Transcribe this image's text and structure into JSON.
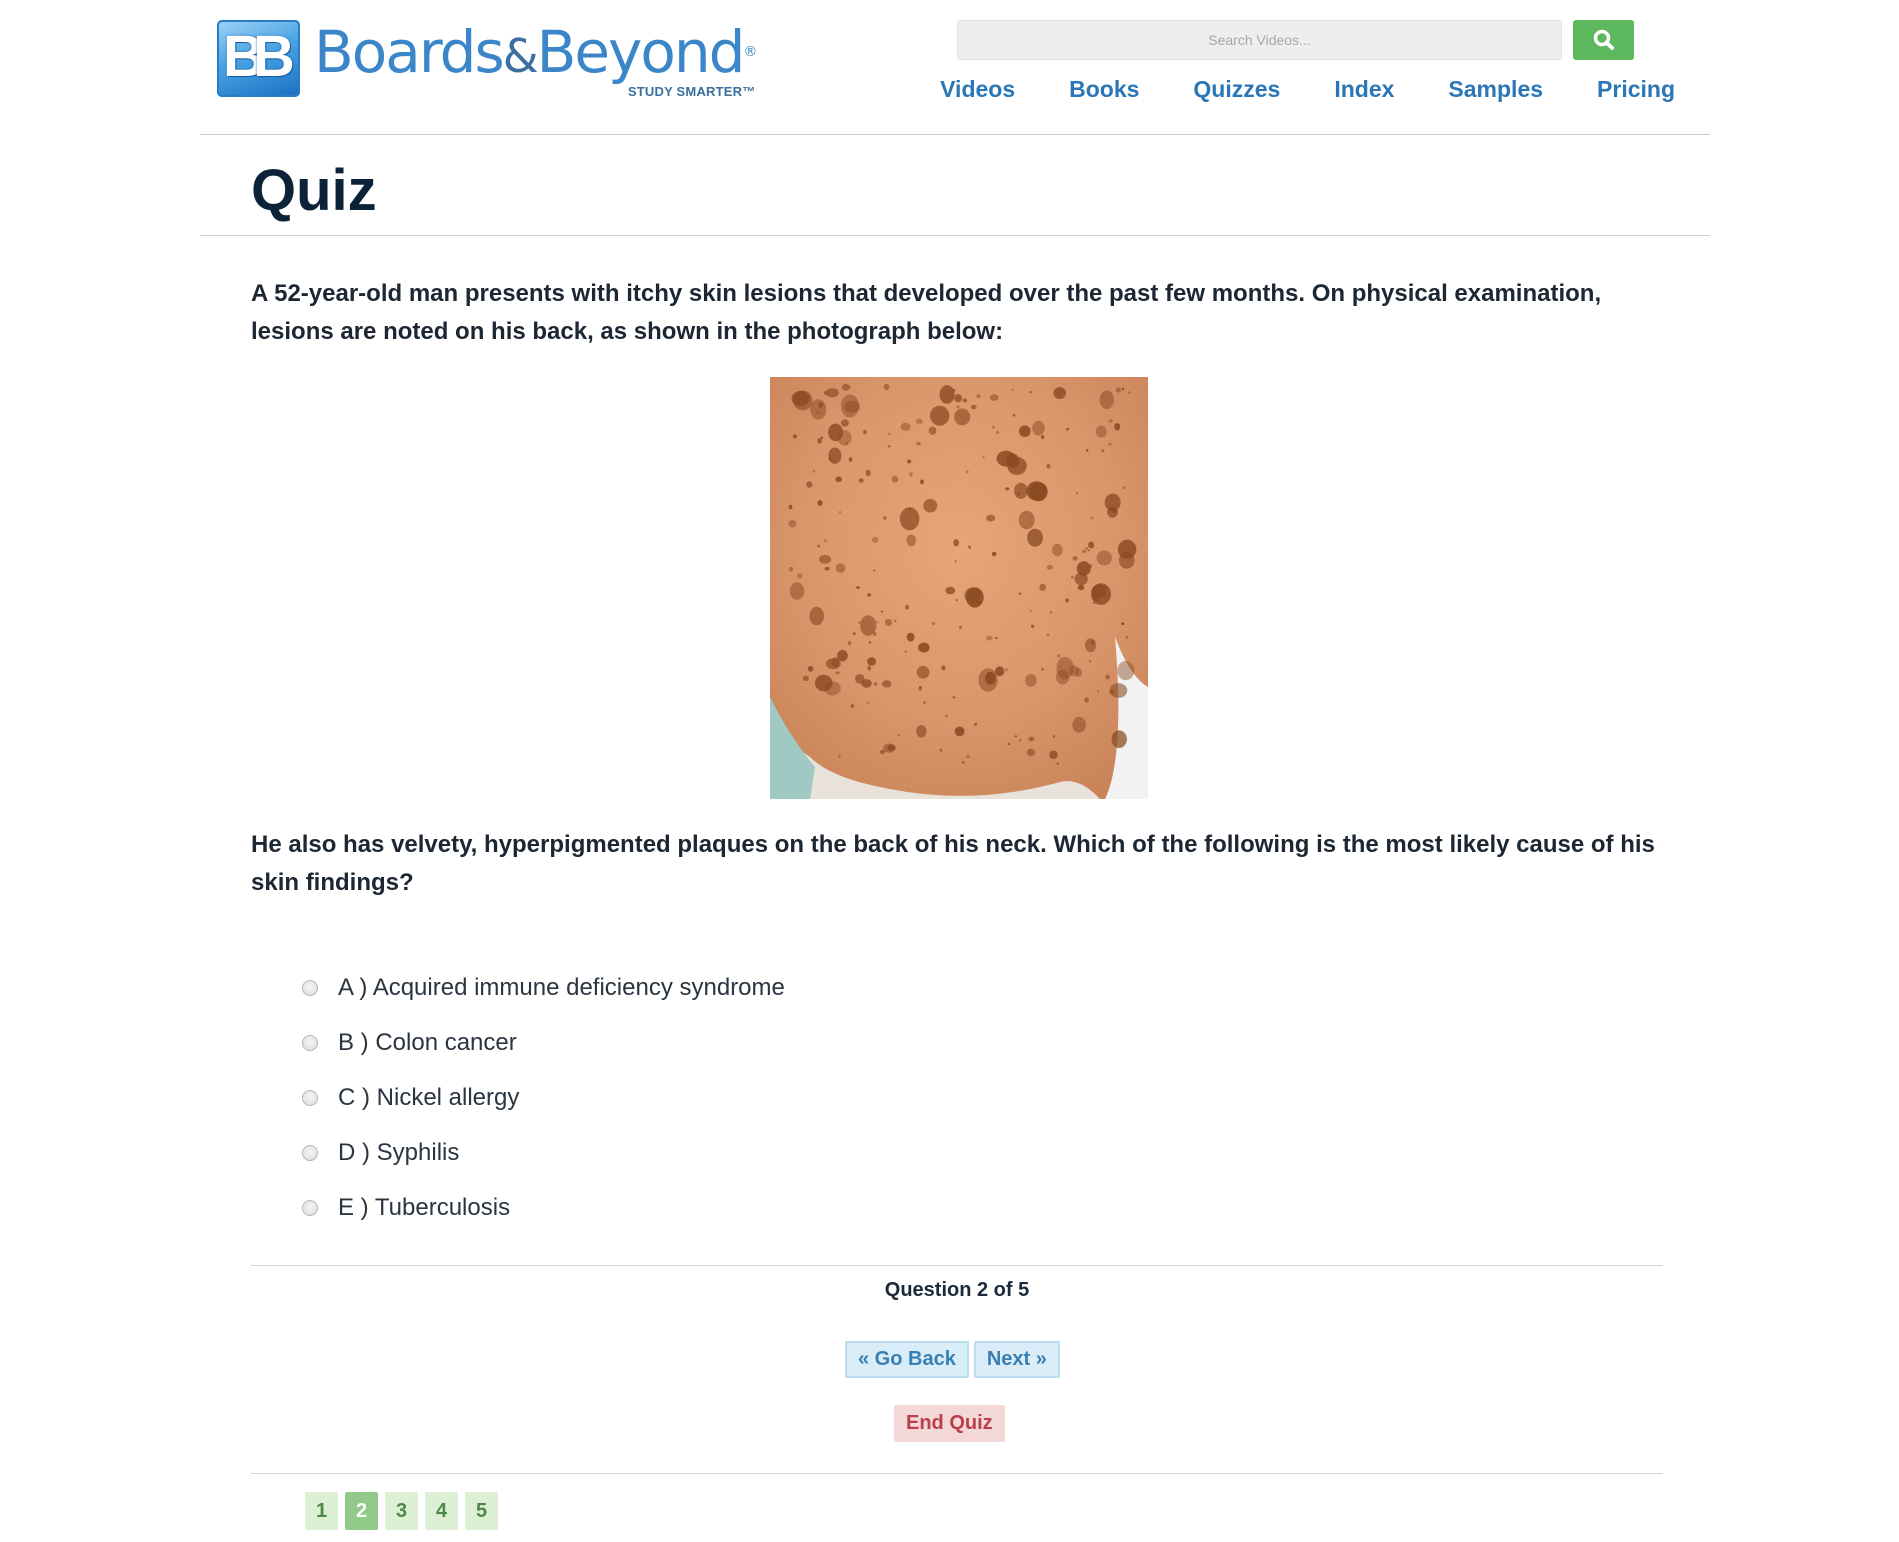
{
  "brand": {
    "mark": [
      "B",
      "B"
    ],
    "name_part1": "Boards",
    "name_amp": "&",
    "name_part2": "Beyond",
    "registered": "®",
    "tagline": "STUDY SMARTER™"
  },
  "search": {
    "placeholder": "Search Videos...",
    "button_icon": "search-icon"
  },
  "nav": {
    "items": [
      {
        "label": "Videos"
      },
      {
        "label": "Books"
      },
      {
        "label": "Quizzes"
      },
      {
        "label": "Index"
      },
      {
        "label": "Samples"
      },
      {
        "label": "Pricing"
      }
    ]
  },
  "page": {
    "title": "Quiz"
  },
  "question": {
    "stem_part1": "A 52-year-old man presents with itchy skin lesions that developed over the past few months. On physical examination, lesions are noted on his back, as shown in the photograph below:",
    "stem_part2": "He also has velvety, hyperpigmented plaques on the back of his neck. Which of the following is the most likely cause of his skin findings?",
    "choices": [
      {
        "label": "A ) Acquired immune deficiency syndrome",
        "selected": false
      },
      {
        "label": "B ) Colon cancer",
        "selected": false
      },
      {
        "label": "C ) Nickel allergy",
        "selected": false
      },
      {
        "label": "D ) Syphilis",
        "selected": false
      },
      {
        "label": "E ) Tuberculosis",
        "selected": false
      }
    ]
  },
  "progress": {
    "text": "Question 2 of 5",
    "current": 2,
    "total": 5
  },
  "buttons": {
    "back": "« Go Back",
    "next": "Next »",
    "end": "End Quiz"
  },
  "pager": {
    "pages": [
      "1",
      "2",
      "3",
      "4",
      "5"
    ],
    "active_index": 1
  },
  "colors": {
    "nav_link": "#2a76b7",
    "search_button": "#5cb85c",
    "title": "#0c2238",
    "nav_button_bg": "#d9edf8",
    "end_button_bg": "#f4d8d8",
    "end_button_text": "#b9404a",
    "pager_bg": "#ddefd5",
    "pager_active_bg": "#91c988"
  }
}
